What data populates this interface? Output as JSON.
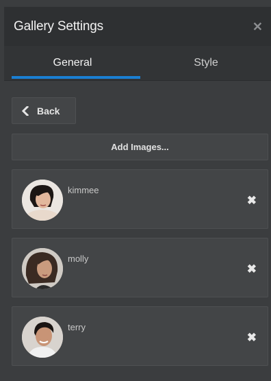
{
  "header": {
    "title": "Gallery Settings",
    "close_icon": "close-icon"
  },
  "tabs": [
    {
      "label": "General",
      "active": true
    },
    {
      "label": "Style",
      "active": false
    }
  ],
  "actions": {
    "back_label": "Back",
    "add_images_label": "Add Images..."
  },
  "images": [
    {
      "name": "kimmee"
    },
    {
      "name": "molly"
    },
    {
      "name": "terry"
    }
  ],
  "colors": {
    "accent": "#1a7fd3",
    "panel_bg": "#3b3d3f",
    "header_bg": "#2e3032"
  }
}
